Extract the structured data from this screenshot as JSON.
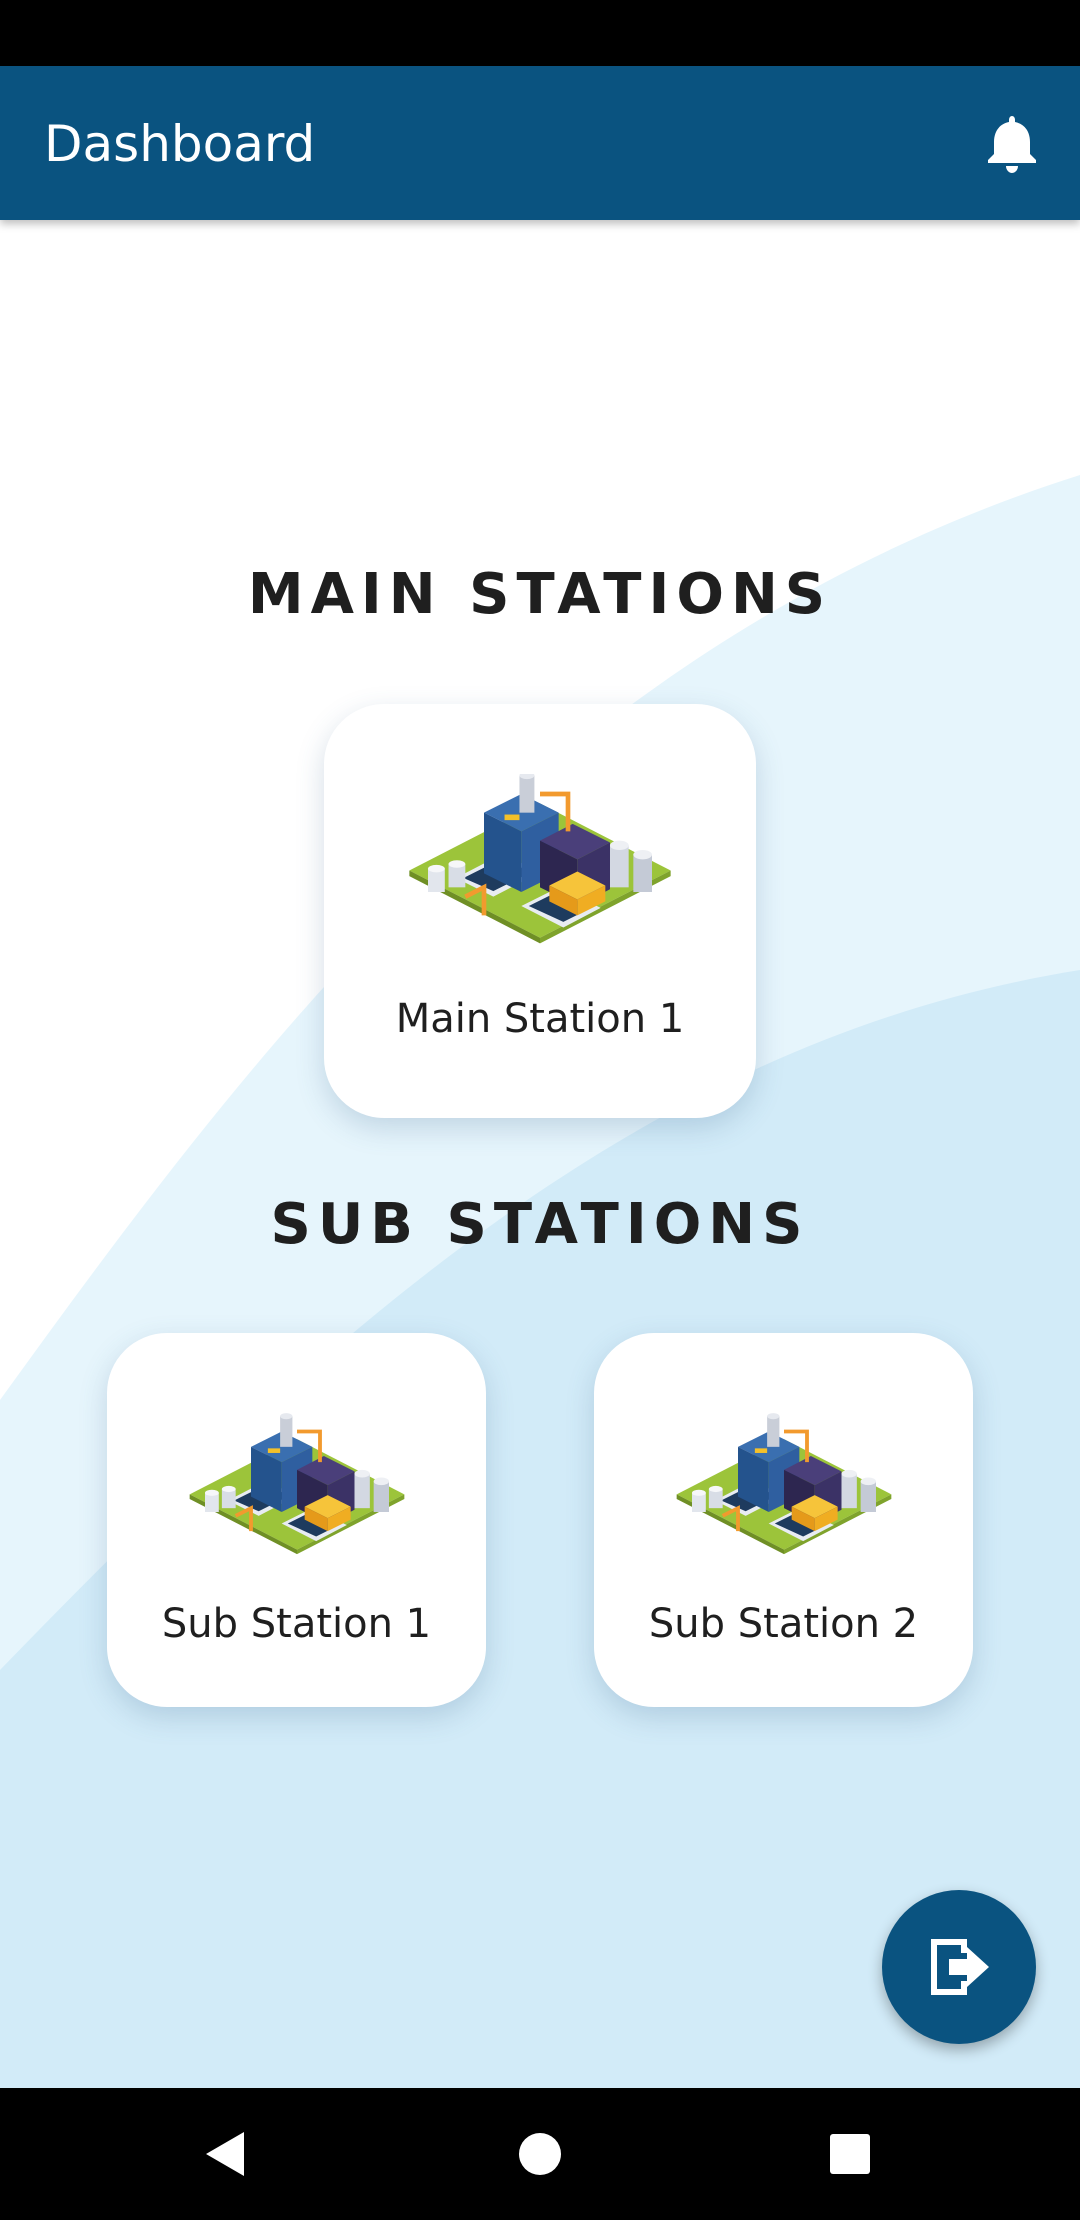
{
  "app_bar": {
    "title": "Dashboard",
    "notification_icon": "bell-icon"
  },
  "main_section": {
    "title": "MAIN STATIONS",
    "stations": [
      {
        "label": "Main Station 1",
        "icon": "factory-illustration"
      }
    ]
  },
  "sub_section": {
    "title": "SUB STATIONS",
    "stations": [
      {
        "label": "Sub Station 1",
        "icon": "factory-illustration"
      },
      {
        "label": "Sub Station 2",
        "icon": "factory-illustration"
      }
    ]
  },
  "fab": {
    "icon": "logout-icon"
  },
  "system_nav": {
    "back_icon": "back-triangle-icon",
    "home_icon": "home-circle-icon",
    "recents_icon": "recents-square-icon"
  },
  "colors": {
    "primary": "#0a5380",
    "wave_light": "#e6f5fc",
    "wave_mid": "#d2ebf8",
    "text": "#1f1f1f"
  }
}
